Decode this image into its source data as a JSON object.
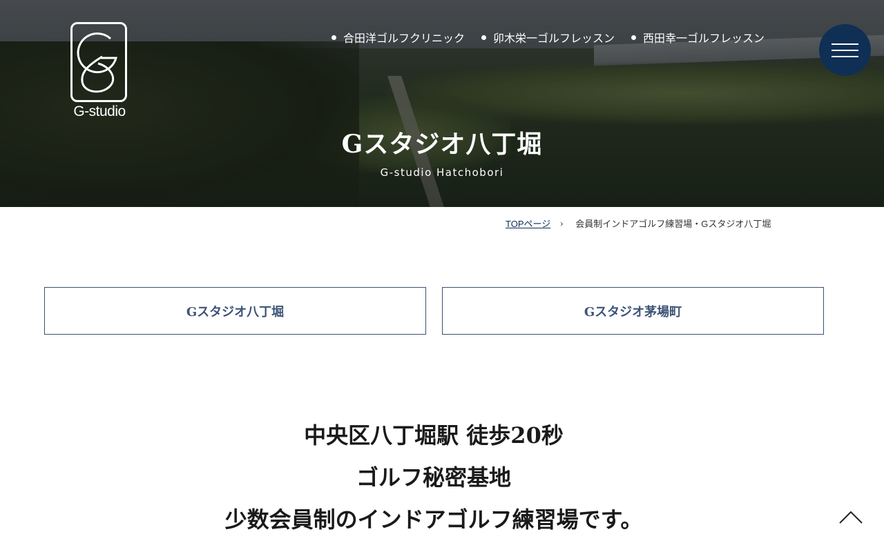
{
  "logo": {
    "wordmark": "G-studio"
  },
  "nav": {
    "items": [
      {
        "label": "合田洋ゴルフクリニック"
      },
      {
        "label": "卯木栄一ゴルフレッスン"
      },
      {
        "label": "西田幸一ゴルフレッスン"
      }
    ],
    "menu_icon": "hamburger-icon",
    "accent_color": "#0f2f55"
  },
  "hero": {
    "title": "Gスタジオ八丁堀",
    "subtitle": "G-studio Hatchobori"
  },
  "breadcrumb": {
    "home": "TOPページ",
    "separator": "›",
    "current": "会員制インドアゴルフ練習場・Gスタジオ八丁堀"
  },
  "tabs": [
    {
      "label": "Gスタジオ八丁堀"
    },
    {
      "label": "Gスタジオ茅場町"
    }
  ],
  "headline": {
    "line1": "中央区八丁堀駅 徒歩20秒",
    "line2": "ゴルフ秘密基地",
    "line3": "少数会員制のインドアゴルフ練習場です。"
  },
  "page_top_icon": "chevron-up-icon"
}
